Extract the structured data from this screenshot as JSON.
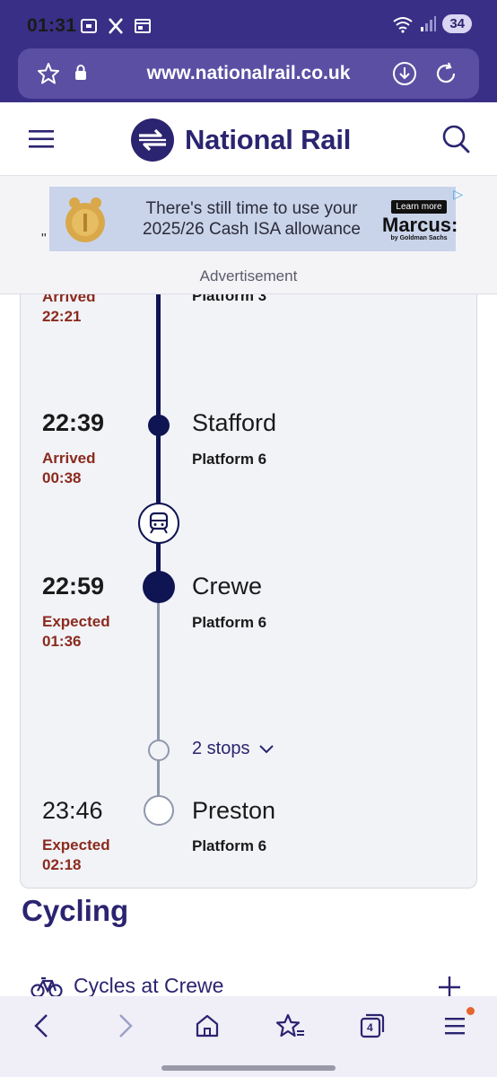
{
  "status_bar": {
    "time": "01:31",
    "battery": "34"
  },
  "browser": {
    "url": "www.nationalrail.co.uk",
    "tab_count": "4"
  },
  "header": {
    "brand": "National Rail"
  },
  "ad": {
    "text_line1": "There's still time to use your",
    "text_line2": "2025/26 Cash ISA allowance",
    "learn_more": "Learn more",
    "advertiser": "Marcus:",
    "advertiser_sub": "by Goldman Sachs",
    "quote_mark": "\"",
    "label": "Advertisement"
  },
  "journey": {
    "partial_stop": {
      "status": "Arrived",
      "actual": "22:21",
      "platform": "Platform 3"
    },
    "stops": [
      {
        "time": "22:39",
        "station": "Stafford",
        "platform": "Platform 6",
        "status": "Arrived",
        "actual": "00:38"
      },
      {
        "time": "22:59",
        "station": "Crewe",
        "platform": "Platform 6",
        "status": "Expected",
        "actual": "01:36"
      },
      {
        "time": "23:46",
        "station": "Preston",
        "platform": "Platform 6",
        "status": "Expected",
        "actual": "02:18"
      }
    ],
    "intermediate_stops": "2 stops"
  },
  "cycling": {
    "heading": "Cycling",
    "item_label": "Cycles at Crewe"
  },
  "colors": {
    "brand_purple": "#3a2f86",
    "navy": "#0f1452",
    "delay_red": "#8b2a1e"
  }
}
